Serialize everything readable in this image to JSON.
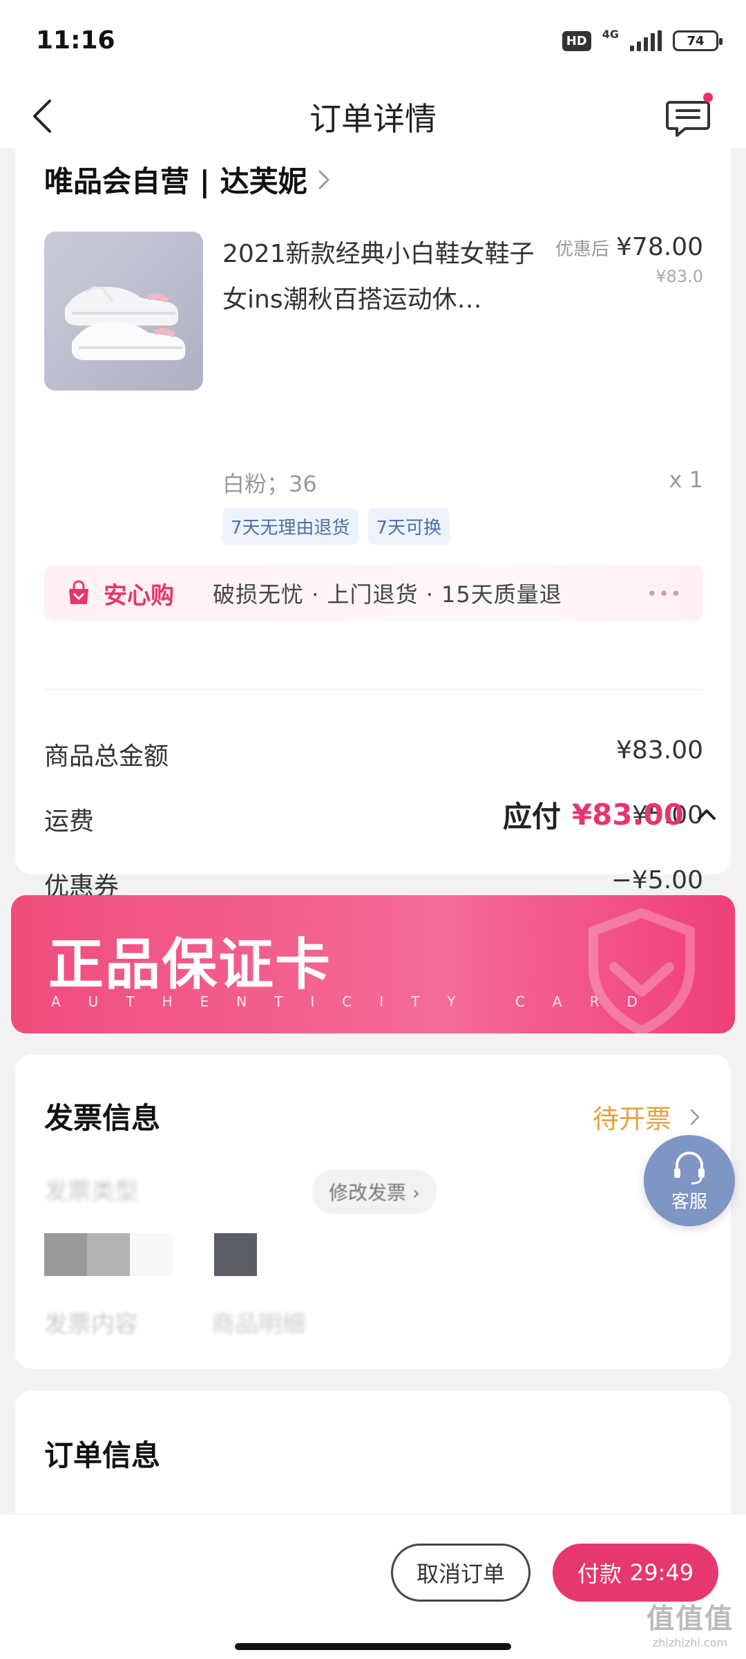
{
  "status_bar": {
    "time": "11:16",
    "hd": "HD",
    "network": "4G",
    "battery": "74"
  },
  "nav": {
    "title": "订单详情"
  },
  "shop": {
    "name": "唯品会自营 | 达芙妮"
  },
  "product": {
    "name": "2021新款经典小白鞋女鞋子女ins潮秋百搭运动休…",
    "price_label": "优惠后",
    "price": "¥78.00",
    "original_price": "¥83.0",
    "sku": "白粉；36",
    "quantity": "x 1",
    "tags": [
      "7天无理由退货",
      "7天可换"
    ]
  },
  "assurance": {
    "title": "安心购",
    "text": "破损无忧 · 上门退货 · 15天质量退",
    "more": "•••"
  },
  "fees": [
    {
      "label": "商品总金额",
      "value": "¥83.00"
    },
    {
      "label": "运费",
      "value": "¥5.00"
    },
    {
      "label": "优惠券",
      "value": "−¥5.00"
    }
  ],
  "payable": {
    "label": "应付",
    "amount": "¥83.00"
  },
  "auth_card": {
    "title": "正品保证卡",
    "subtitle": "AUTHENTICITY CARD"
  },
  "invoice": {
    "title": "发票信息",
    "status": "待开票",
    "type_label": "发票类型",
    "change_button": "修改发票",
    "content_label": "发票内容",
    "content_value": "商品明细"
  },
  "service": {
    "label": "客服"
  },
  "order_info": {
    "title": "订单信息"
  },
  "actions": {
    "cancel": "取消订单",
    "pay": "付款",
    "countdown": "29:49"
  },
  "watermark": {
    "main": "值值值",
    "url": "zhizhizhi.com"
  },
  "colors": {
    "accent": "#e6386c",
    "invoice_status": "#e8a13a",
    "service_bg": "#7f95c3"
  }
}
